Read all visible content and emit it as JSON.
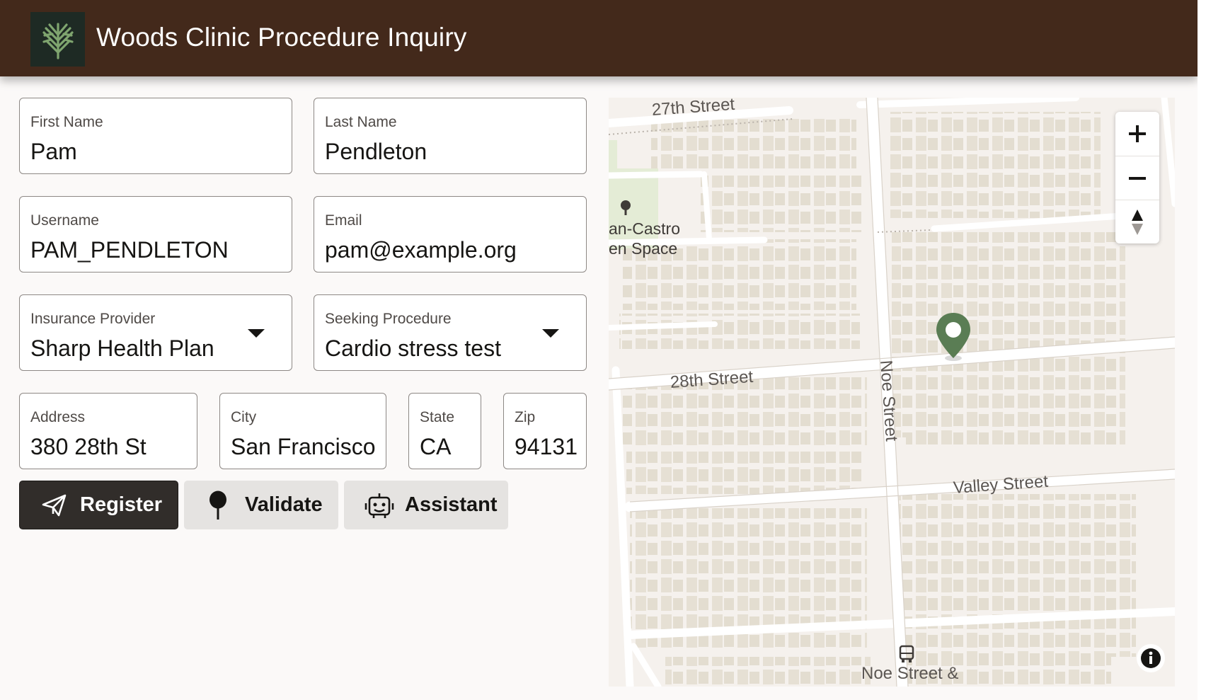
{
  "header": {
    "title": "Woods Clinic Procedure Inquiry",
    "logo_icon": "tree-logo-icon",
    "background": "#43291b"
  },
  "form": {
    "first_name": {
      "label": "First Name",
      "value": "Pam"
    },
    "last_name": {
      "label": "Last Name",
      "value": "Pendleton"
    },
    "username": {
      "label": "Username",
      "value": "PAM_PENDLETON"
    },
    "email": {
      "label": "Email",
      "value": "pam@example.org"
    },
    "insurance": {
      "label": "Insurance Provider",
      "value": "Sharp Health Plan"
    },
    "procedure": {
      "label": "Seeking Procedure",
      "value": "Cardio stress test"
    },
    "address": {
      "label": "Address",
      "value": "380 28th St"
    },
    "city": {
      "label": "City",
      "value": "San Francisco"
    },
    "state": {
      "label": "State",
      "value": "CA"
    },
    "zip": {
      "label": "Zip",
      "value": "94131"
    }
  },
  "actions": {
    "register": {
      "label": "Register",
      "icon": "paper-plane-icon"
    },
    "validate": {
      "label": "Validate",
      "icon": "map-pin-icon"
    },
    "assistant": {
      "label": "Assistant",
      "icon": "robot-icon"
    }
  },
  "map": {
    "streets": {
      "s27": "27th Street",
      "s28": "28th Street",
      "noe": "Noe Street",
      "valley": "Valley Street",
      "noe_stop": "Noe Street &"
    },
    "poi": {
      "line1": "an-Castro",
      "line2": "en Space"
    },
    "controls": {
      "zoom_in": "+",
      "zoom_out": "−"
    },
    "marker_color": "#5a7d54"
  },
  "colors": {
    "accent_dark": "#312d2a",
    "button_secondary": "#e5e3e1",
    "page_bg": "#fbf9f8"
  }
}
